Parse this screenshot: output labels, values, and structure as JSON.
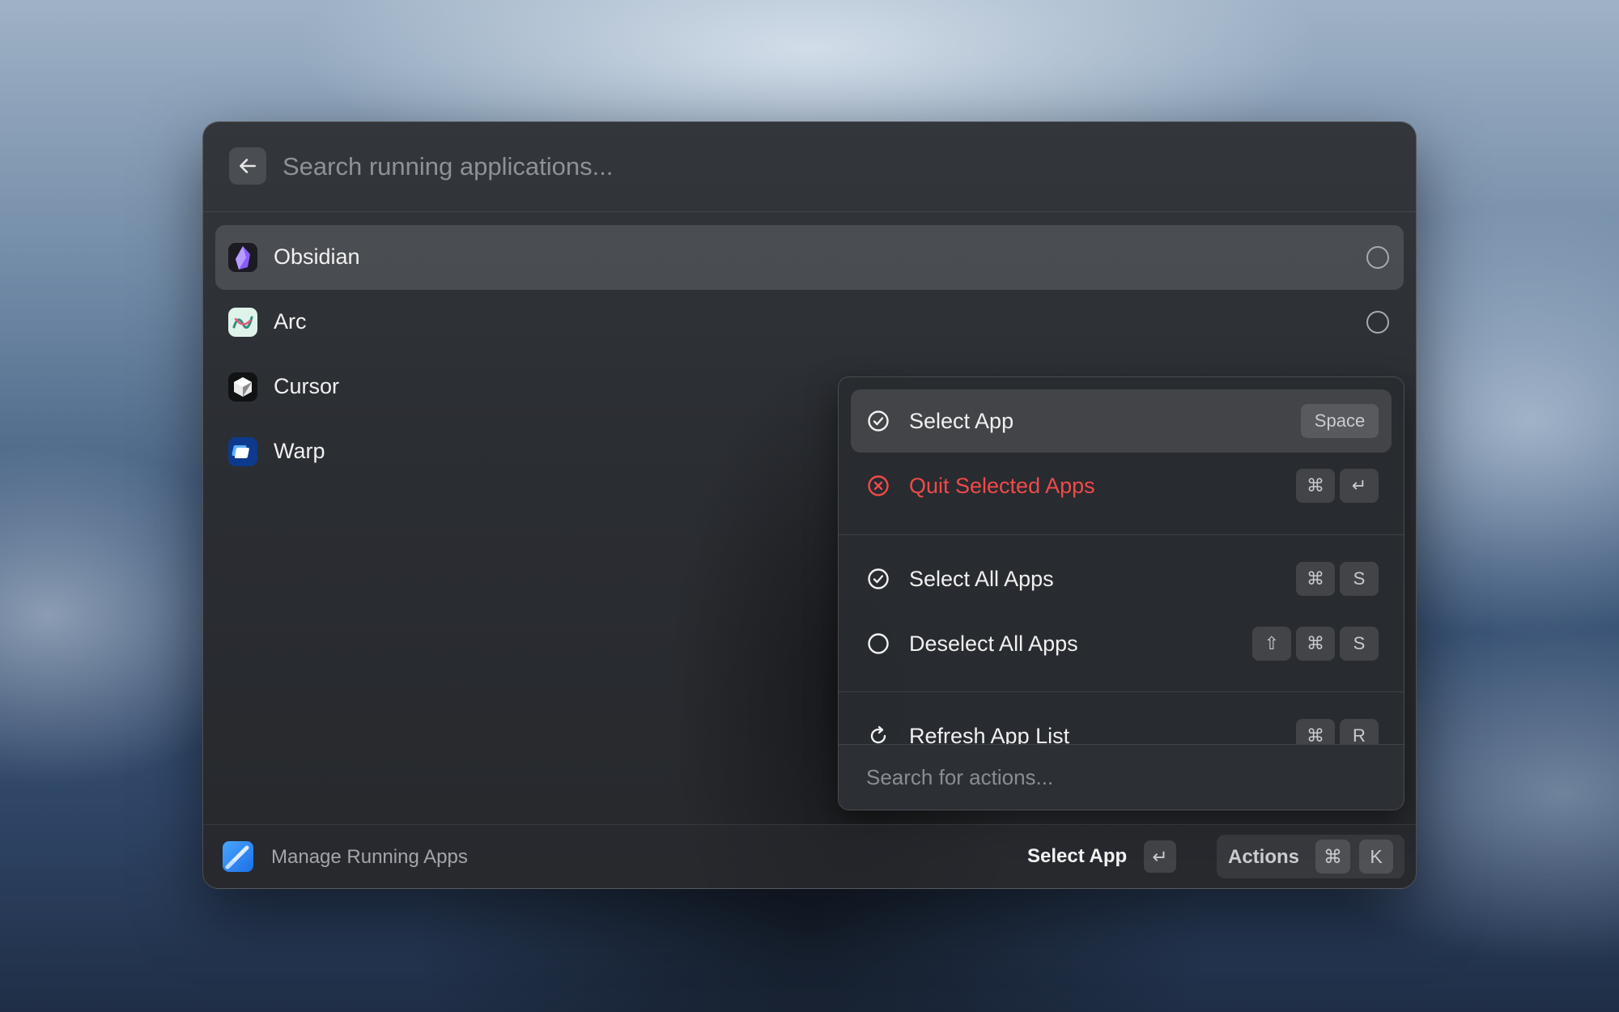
{
  "search": {
    "placeholder": "Search running applications..."
  },
  "apps": [
    {
      "name": "Obsidian",
      "icon": "obsidian-icon",
      "selected": true
    },
    {
      "name": "Arc",
      "icon": "arc-icon"
    },
    {
      "name": "Cursor",
      "icon": "cursor-icon"
    },
    {
      "name": "Warp",
      "icon": "warp-icon"
    }
  ],
  "actions_panel": {
    "items": [
      {
        "label": "Select App",
        "icon": "check-circle-icon",
        "keys": [
          "Space"
        ]
      },
      {
        "label": "Quit Selected Apps",
        "icon": "x-circle-icon",
        "keys": [
          "⌘",
          "↵"
        ],
        "color": "#f04a4a"
      },
      {
        "label": "Select All Apps",
        "icon": "check-circle-icon",
        "keys": [
          "⌘",
          "S"
        ]
      },
      {
        "label": "Deselect All Apps",
        "icon": "empty-circle-icon",
        "keys": [
          "⇧",
          "⌘",
          "S"
        ]
      },
      {
        "label": "Refresh App List",
        "icon": "refresh-icon",
        "keys": [
          "⌘",
          "R"
        ]
      }
    ],
    "search_placeholder": "Search for actions..."
  },
  "footer": {
    "extension_title": "Manage Running Apps",
    "primary_action": "Select App",
    "primary_key": "↵",
    "actions_label": "Actions",
    "actions_keys": [
      "⌘",
      "K"
    ]
  }
}
